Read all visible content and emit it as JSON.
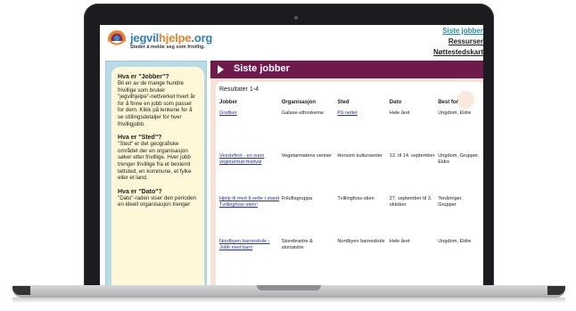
{
  "site": {
    "name_part1": "jegvil",
    "name_highlight": "hjelpe",
    "name_suffix": ".org",
    "tagline": "Stedet å melde seg som frivillig."
  },
  "top_links": [
    "Siste jobber",
    "Ressurser",
    "Nøttestedskart"
  ],
  "sidebar": {
    "sections": [
      {
        "question": "Hva er \"Jobber\"?",
        "text": "Bli en av de mange hundre frivillige som bruker \"jegvilhjelpe\"-nettverket hvert år for å finne en jobb som passer for dem. Klikk på lenkene for å se stillingsdetaljer for hver frivilligjobb."
      },
      {
        "question": "Hva er \"Sted\"?",
        "text": "\"Sted\" er det geografiske området der en organisasjon søker etter frivillige. Hver jobb trenger frivillige fra et bestemt tettsted, en kommune, et fylke eller et land."
      },
      {
        "question": "Hva er \"Dato\"?",
        "text": "\"Dato\"-raden viser den perioden en ideell organisasjon trenger"
      }
    ]
  },
  "main": {
    "title": "Siste jobber",
    "results_label": "Resultater 1-4",
    "columns": [
      "Jobber",
      "Organisasjon",
      "Sted",
      "Dato",
      "Best for"
    ],
    "rows": [
      [
        "Grafiker",
        "Galaxe-utforskeme",
        "På nettet",
        "Hele året",
        "Ungdom, Eldre"
      ],
      [
        "Vesslefest - en sunn vegetarmat-festival",
        "Vegetarmatens venner",
        "Horsont kultursenter",
        "12. til 14. september",
        "Ungdom, Grupper, Eldre"
      ],
      [
        "Hjelp til med å sette i stand Tvillingfoss-stien!",
        "Friluftsgruppa",
        "Tvillingfoss-stien",
        "27. september til 3. oktober",
        "Tenåringer, Grupper"
      ],
      [
        "Nordbyen barneskole - Jobb med barn",
        "Storebrødre & storsøstre",
        "Nordbyen barneskole",
        "Hele året",
        "Ungdom, Eldre"
      ]
    ]
  }
}
